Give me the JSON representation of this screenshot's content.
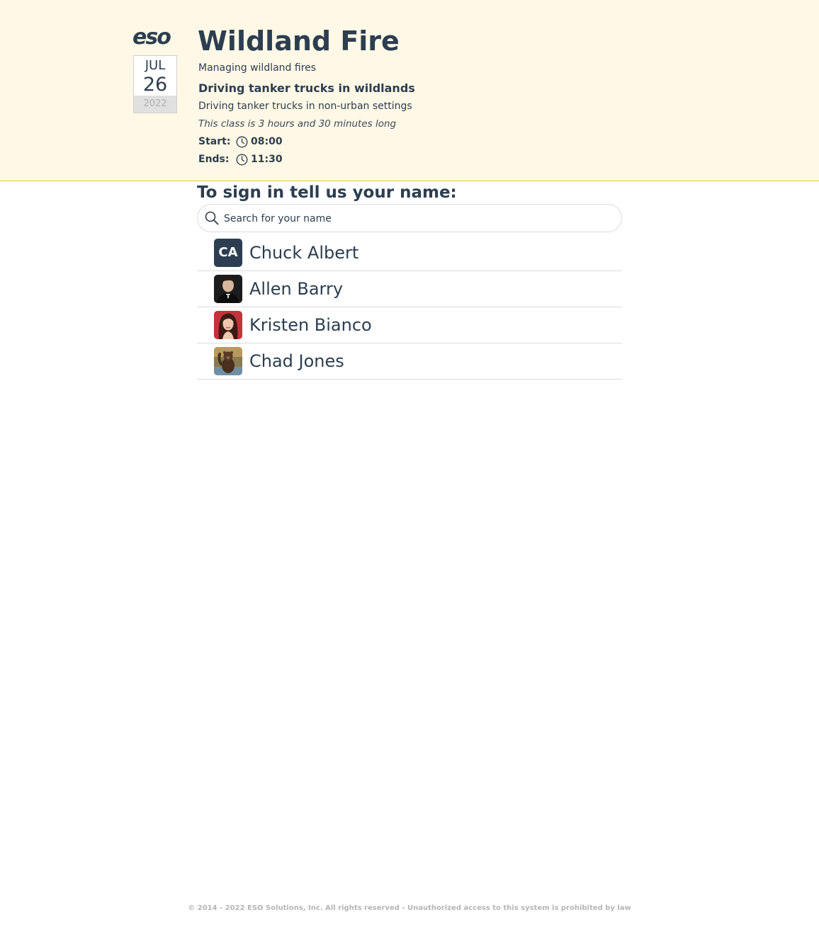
{
  "brand": {
    "logo_text": "eso"
  },
  "date": {
    "month": "JUL",
    "day": "26",
    "year": "2022"
  },
  "class": {
    "title": "Wildland Fire",
    "subtitle": "Managing wildland fires",
    "course_name": "Driving tanker trucks in wildlands",
    "course_description": "Driving tanker trucks in non-urban settings",
    "duration_note": "This class is 3 hours and 30 minutes long",
    "start_label": "Start:",
    "start_time": "08:00",
    "end_label": "Ends:",
    "end_time": "11:30"
  },
  "signin": {
    "prompt": "To sign in tell us your name:",
    "search_placeholder": "Search for your name"
  },
  "people": [
    {
      "name": "Chuck Albert",
      "initials": "CA",
      "avatar": "initials"
    },
    {
      "name": "Allen Barry",
      "avatar": "photo-man-in-tuxedo"
    },
    {
      "name": "Kristen Bianco",
      "avatar": "photo-woman-red-background"
    },
    {
      "name": "Chad Jones",
      "avatar": "photo-bear-waving"
    }
  ],
  "footer": {
    "text": "© 2014 - 2022 ESO Solutions, Inc. All rights reserved - Unauthorized access to this system is prohibited by law"
  },
  "colors": {
    "header_bg": "#fff8e6",
    "header_border": "#e8c44a",
    "text": "#2c3e50"
  }
}
